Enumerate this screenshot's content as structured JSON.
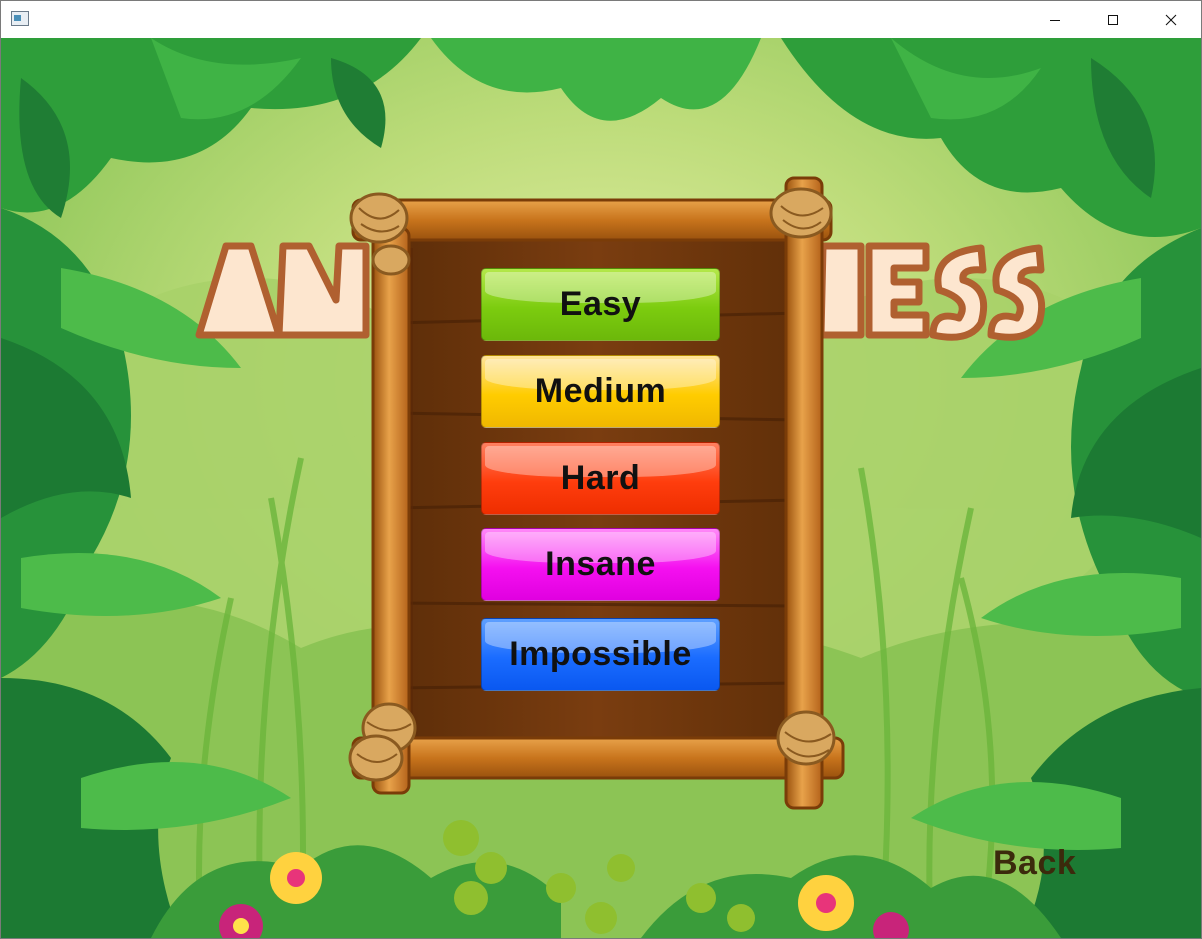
{
  "window": {
    "controls": {
      "minimize": "minimize-icon",
      "maximize": "maximize-icon",
      "close": "close-icon"
    }
  },
  "title_logo": {
    "left_visible": "AN",
    "right_visible": "HESS"
  },
  "difficulty_menu": {
    "buttons": [
      {
        "label": "Easy",
        "color": "#7ccc0f"
      },
      {
        "label": "Medium",
        "color": "#ffcc00"
      },
      {
        "label": "Hard",
        "color": "#ff3d0d"
      },
      {
        "label": "Insane",
        "color": "#f510f0"
      },
      {
        "label": "Impossible",
        "color": "#1a6cff"
      }
    ]
  },
  "back_label": "Back"
}
